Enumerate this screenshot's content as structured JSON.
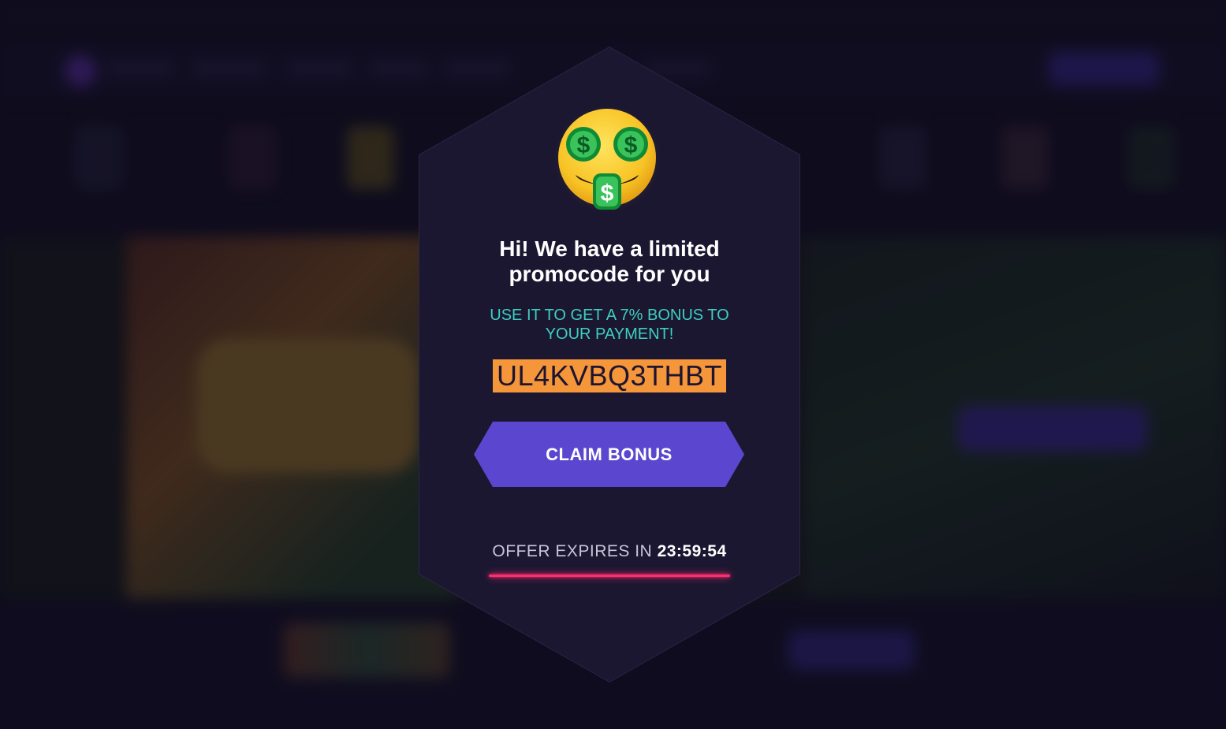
{
  "popup": {
    "title": "Hi! We have a limited\npromocode for you",
    "subtitle": "USE IT TO GET A 7% BONUS TO\nYOUR PAYMENT!",
    "promo_code": "UL4KVBQ3THBT",
    "claim_label": "CLAIM BONUS",
    "expires_label": "OFFER EXPIRES IN",
    "expires_time": "23:59:54",
    "expiry_progress": 1.0,
    "icon": "money-mouth-face-icon"
  },
  "colors": {
    "background": "#120f22",
    "panel": "#1b1731",
    "subtitle": "#3ecfc0",
    "promo_highlight": "#f6963a",
    "button": "#5b47cf",
    "timer_bar": "#ff2d6e"
  }
}
